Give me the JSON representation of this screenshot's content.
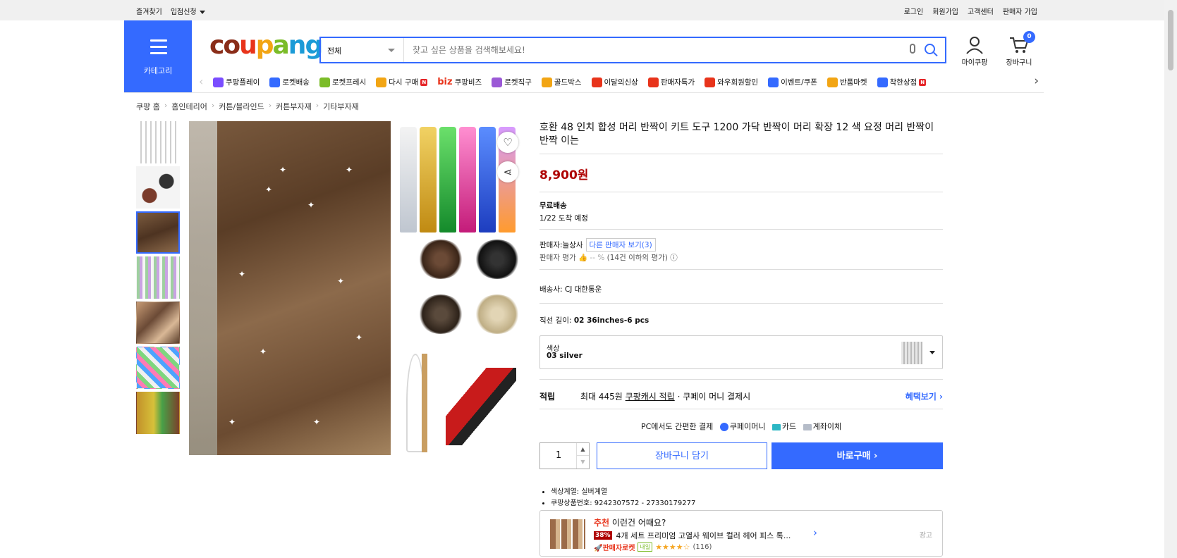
{
  "topbar": {
    "favorites": "즐겨찾기",
    "sell_apply": "입점신청",
    "login": "로그인",
    "signup": "회원가입",
    "customer_center": "고객센터",
    "seller_signup": "판매자 가입"
  },
  "header": {
    "category_label": "카테고리",
    "logo": "coupang",
    "search_scope": "전체",
    "search_placeholder": "찾고 싶은 상품을 검색해보세요!",
    "mycoupang": "마이쿠팡",
    "cart": "장바구니",
    "cart_count": "0"
  },
  "gnb": [
    {
      "label": "쿠팡플레이",
      "color": "#7a4dff"
    },
    {
      "label": "로켓배송",
      "color": "#346aff"
    },
    {
      "label": "로켓프레시",
      "color": "#7bbc28"
    },
    {
      "label": "다시 구매",
      "color": "#f2a514"
    },
    {
      "label": "쿠팡비즈",
      "color": "#333333",
      "prefix": "biz"
    },
    {
      "label": "로켓직구",
      "color": "#9b59d6"
    },
    {
      "label": "골드박스",
      "color": "#f2a514"
    },
    {
      "label": "이달의신상",
      "color": "#e8341b"
    },
    {
      "label": "판매자특가",
      "color": "#e8341b"
    },
    {
      "label": "와우회원할인",
      "color": "#e8341b"
    },
    {
      "label": "이벤트/쿠폰",
      "color": "#346aff"
    },
    {
      "label": "반품마켓",
      "color": "#f2a514"
    },
    {
      "label": "착한상점",
      "color": "#346aff"
    }
  ],
  "breadcrumb": [
    "쿠팡 홈",
    "홈인테리어",
    "커튼/블라인드",
    "커튼부자재",
    "기타부자재"
  ],
  "product": {
    "title": "호환 48 인치 합성 머리 반짝이 키트 도구 1200 가닥 반짝이 머리 확장 12 색 요정 머리 반짝이 반짝 이는",
    "price": "8,900원",
    "shipping_label": "무료배송",
    "arrival": "1/22 도착 예정",
    "seller_label": "판매자:",
    "seller_name": "늘상사",
    "other_sellers": "다른 판매자 보기(3)",
    "seller_rating_label": "판매자 평가",
    "seller_rating_value": "-- %",
    "seller_rating_note": "(14건 이하의 평가)",
    "carrier_label": "배송사:",
    "carrier_name": "CJ 대한통운",
    "length_label": "직선 길이:",
    "length_value": "02 36inches-6 pcs",
    "color_label": "색상",
    "color_value": "03 silver",
    "reward_label": "적립",
    "reward_text": "최대 445원",
    "reward_cash": "쿠팡캐시 적립",
    "reward_tail": "· 쿠페이 머니 결제시",
    "benefit_link": "혜택보기",
    "pc_pay": "PC에서도 간편한 결제",
    "pay_money": "쿠페이머니",
    "pay_card": "카드",
    "pay_bank": "계좌이체",
    "quantity": "1",
    "add_cart": "장바구니 담기",
    "buy_now": "바로구매",
    "attr1": "색상계열: 실버계열",
    "attr2": "쿠팡상품번호: 9242307572 - 27330179277"
  },
  "recommend": {
    "prefix": "추천",
    "headline": "이런건 어때요?",
    "discount": "38%",
    "name": "4개 세트 프리미엄 고열사 웨이브 컬러 헤어 피스 톡...",
    "rocket_label": "판매자로켓",
    "tomorrow": "내일",
    "stars": "★★★★☆",
    "reviews": "(116)",
    "ad": "광고"
  }
}
